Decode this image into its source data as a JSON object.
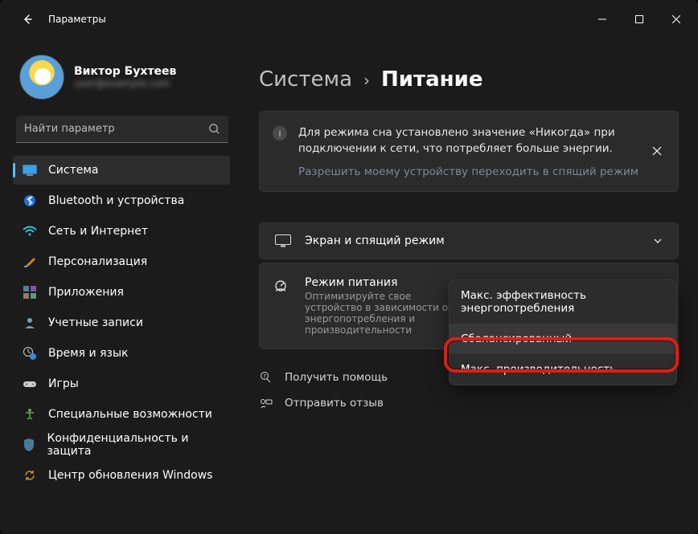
{
  "window": {
    "title": "Параметры"
  },
  "user": {
    "name": "Виктор Бухтеев",
    "email": "user@example.com"
  },
  "search": {
    "placeholder": "Найти параметр"
  },
  "sidebar": {
    "items": [
      {
        "label": "Система"
      },
      {
        "label": "Bluetooth и устройства"
      },
      {
        "label": "Сеть и Интернет"
      },
      {
        "label": "Персонализация"
      },
      {
        "label": "Приложения"
      },
      {
        "label": "Учетные записи"
      },
      {
        "label": "Время и язык"
      },
      {
        "label": "Игры"
      },
      {
        "label": "Специальные возможности"
      },
      {
        "label": "Конфиденциальность и защита"
      },
      {
        "label": "Центр обновления Windows"
      }
    ]
  },
  "breadcrumb": {
    "parent": "Система",
    "current": "Питание"
  },
  "banner": {
    "text": "Для режима сна установлено значение «Никогда» при подключении к сети, что потребляет больше энергии.",
    "link": "Разрешить моему устройству переходить в спящий режим"
  },
  "cards": {
    "screen": {
      "title": "Экран и спящий режим"
    },
    "power": {
      "title": "Режим питания",
      "sub": "Оптимизируйте свое устройство в зависимости от энергопотребления и производительности"
    }
  },
  "dropdown": {
    "items": [
      "Макс. эффективность энергопотребления",
      "Сбалансированный",
      "Макс. производительность"
    ]
  },
  "footer": {
    "help": "Получить помощь",
    "feedback": "Отправить отзыв"
  }
}
